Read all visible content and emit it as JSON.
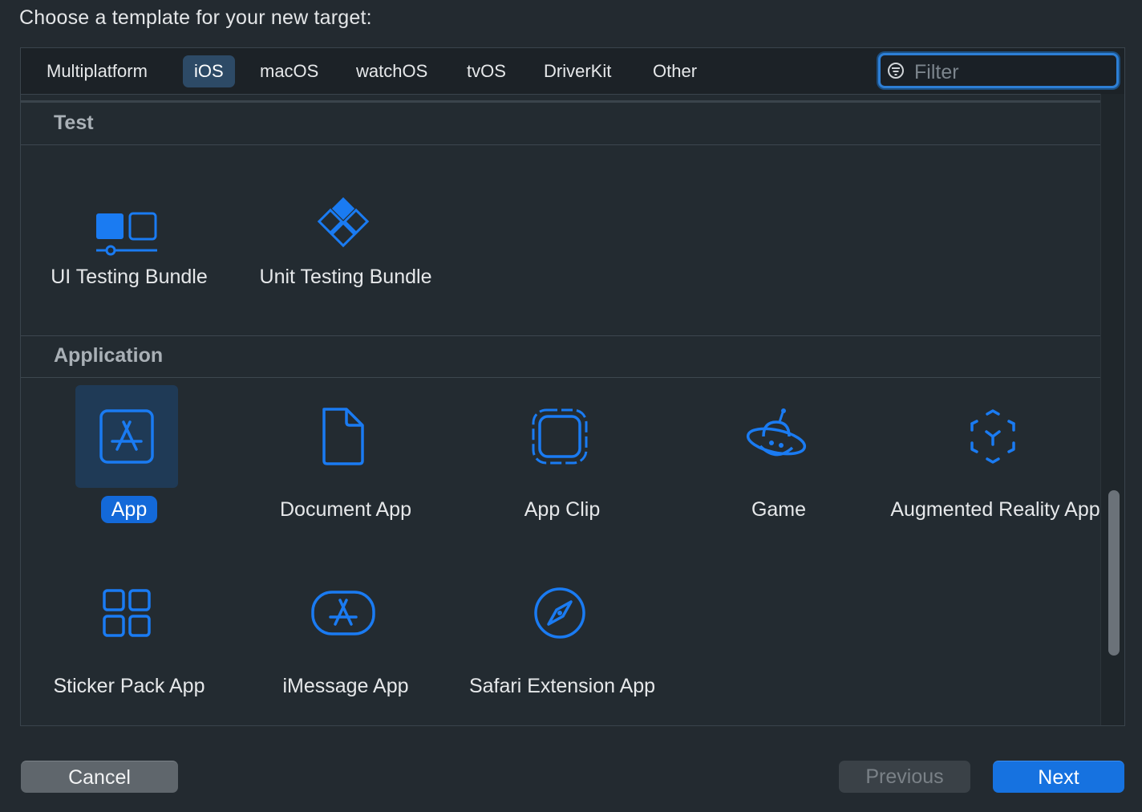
{
  "heading": "Choose a template for your new target:",
  "tabs": [
    {
      "label": "Multiplatform",
      "selected": false
    },
    {
      "label": "iOS",
      "selected": true
    },
    {
      "label": "macOS",
      "selected": false
    },
    {
      "label": "watchOS",
      "selected": false
    },
    {
      "label": "tvOS",
      "selected": false
    },
    {
      "label": "DriverKit",
      "selected": false
    },
    {
      "label": "Other",
      "selected": false
    }
  ],
  "filter": {
    "placeholder": "Filter",
    "value": "",
    "icon": "filter-icon"
  },
  "sections": {
    "test": {
      "title": "Test",
      "items": [
        {
          "label": "UI Testing Bundle",
          "icon": "ui-testing-bundle-icon"
        },
        {
          "label": "Unit Testing Bundle",
          "icon": "unit-testing-bundle-icon"
        }
      ]
    },
    "application": {
      "title": "Application",
      "items": [
        {
          "label": "App",
          "icon": "app-store-icon",
          "selected": true
        },
        {
          "label": "Document App",
          "icon": "document-icon"
        },
        {
          "label": "App Clip",
          "icon": "app-clip-icon"
        },
        {
          "label": "Game",
          "icon": "game-planet-icon"
        },
        {
          "label": "Augmented Reality App",
          "icon": "augmented-reality-icon"
        },
        {
          "label": "Sticker Pack App",
          "icon": "sticker-pack-icon"
        },
        {
          "label": "iMessage App",
          "icon": "imessage-app-icon"
        },
        {
          "label": "Safari Extension App",
          "icon": "safari-compass-icon"
        }
      ]
    }
  },
  "buttons": {
    "cancel": "Cancel",
    "previous": "Previous",
    "next": "Next"
  },
  "colors": {
    "accent": "#1672e0",
    "icon_blue": "#1a7bf2",
    "background": "#232a30"
  }
}
